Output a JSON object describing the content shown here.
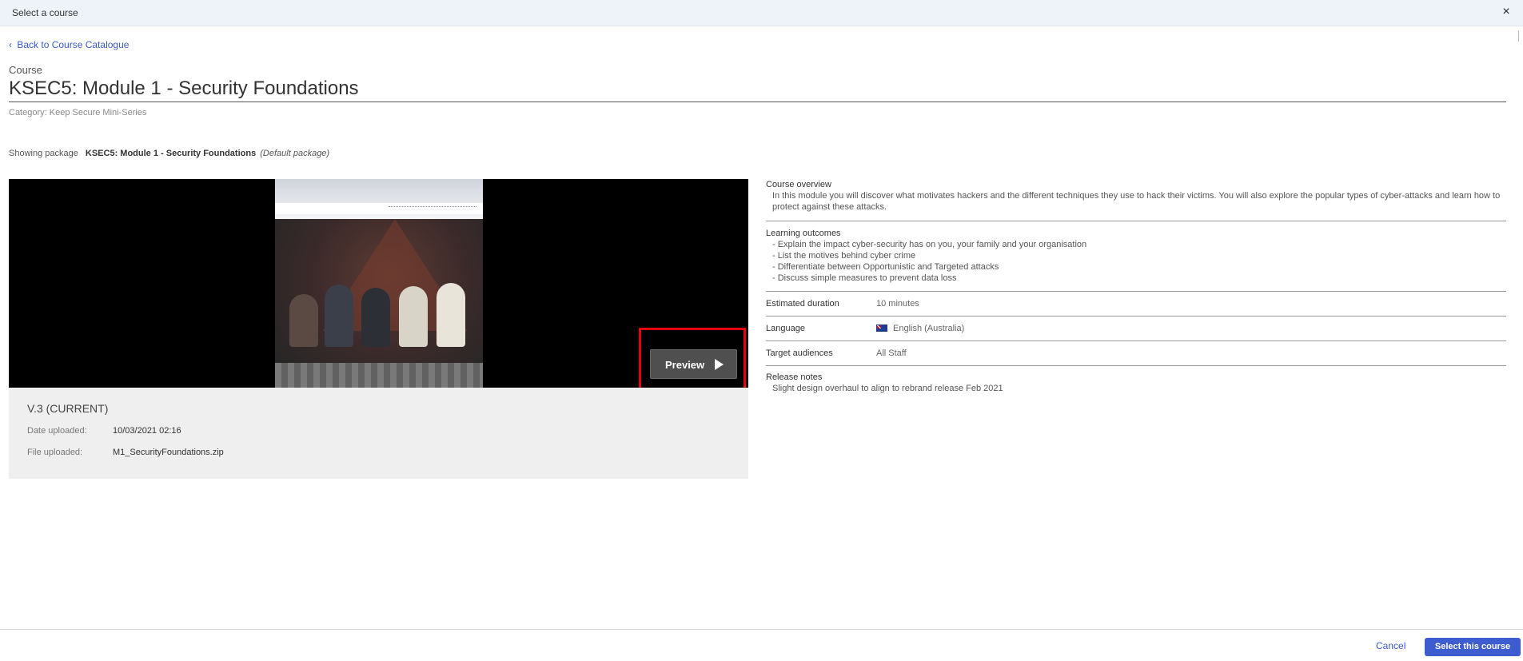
{
  "window": {
    "title": "Select a course",
    "close_glyph": "×"
  },
  "nav": {
    "back_label": "Back to Course Catalogue",
    "back_glyph": "‹"
  },
  "course": {
    "kicker": "Course",
    "title": "KSEC5: Module 1 - Security Foundations",
    "category": "Category: Keep Secure Mini-Series"
  },
  "package": {
    "showing_label": "Showing package",
    "name": "KSEC5: Module 1 - Security Foundations",
    "default_note": "(Default package)"
  },
  "player": {
    "preview_label": "Preview",
    "play_icon": "play-icon",
    "highlight_color": "#e8000c"
  },
  "version": {
    "title": "V.3 (CURRENT)",
    "date_label": "Date uploaded:",
    "date_value": "10/03/2021 02:16",
    "file_label": "File uploaded:",
    "file_value": "M1_SecurityFoundations.zip"
  },
  "details": {
    "overview_heading": "Course overview",
    "overview_text": "In this module you will discover what motivates hackers and the different techniques they use to hack their victims. You will also explore the popular types of cyber-attacks and learn how to protect against these attacks.",
    "outcomes_heading": "Learning outcomes",
    "outcomes": [
      "- Explain the impact cyber-security has on you, your family and your organisation",
      "- List the motives behind cyber crime",
      "- Differentiate between Opportunistic and Targeted attacks",
      "- Discuss simple measures to prevent data loss"
    ],
    "duration_label": "Estimated duration",
    "duration_value": "10 minutes",
    "language_label": "Language",
    "language_value": "English (Australia)",
    "language_flag": "australia-flag-icon",
    "audience_label": "Target audiences",
    "audience_value": "All Staff",
    "release_heading": "Release notes",
    "release_text": "Slight design overhaul to align to rebrand release Feb 2021"
  },
  "footer": {
    "cancel_label": "Cancel",
    "select_label": "Select this course"
  },
  "colors": {
    "accent": "#3c5ccf",
    "link": "#3a5bc7",
    "titlebar_bg": "#eef2f9"
  }
}
